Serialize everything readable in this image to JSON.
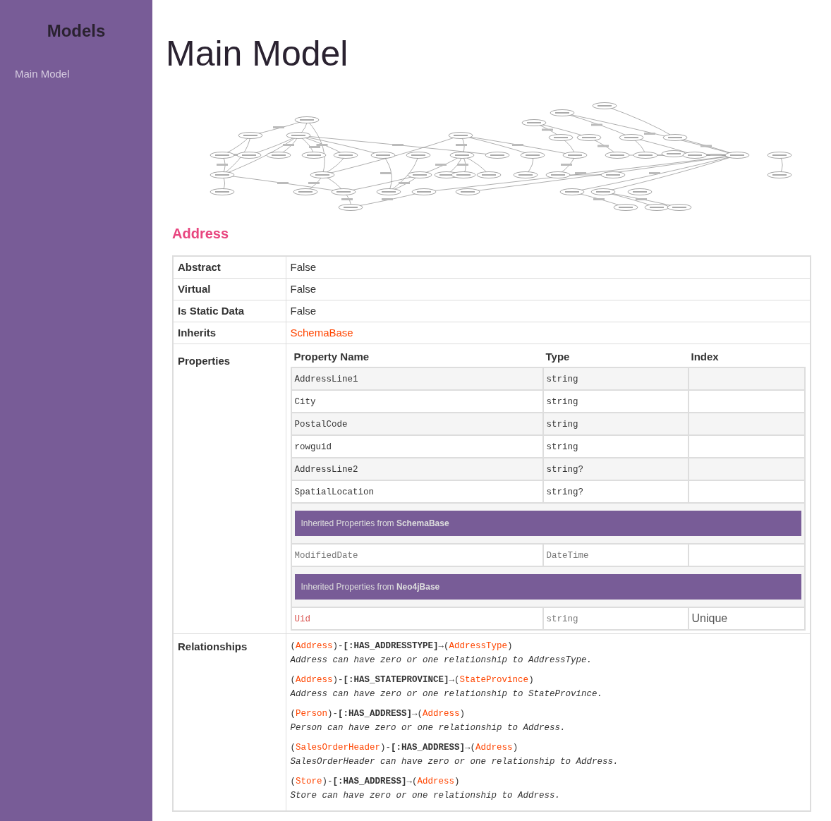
{
  "sidebar": {
    "title": "Models",
    "items": [
      {
        "label": "Main Model",
        "selected": false
      }
    ]
  },
  "page_title": "Main Model",
  "entity": {
    "name": "Address",
    "attributes": [
      {
        "label": "Abstract",
        "value": "False",
        "kind": "text"
      },
      {
        "label": "Virtual",
        "value": "False",
        "kind": "text"
      },
      {
        "label": "Is Static Data",
        "value": "False",
        "kind": "text"
      },
      {
        "label": "Inherits",
        "value": "SchemaBase",
        "kind": "link"
      }
    ],
    "properties": {
      "label": "Properties",
      "columns": [
        "Property Name",
        "Type",
        "Index"
      ],
      "rows": [
        {
          "kind": "property",
          "name": "AddressLine1",
          "type": "string",
          "index": "",
          "inherited": false,
          "highlighted": false
        },
        {
          "kind": "property",
          "name": "City",
          "type": "string",
          "index": "",
          "inherited": false,
          "highlighted": false
        },
        {
          "kind": "property",
          "name": "PostalCode",
          "type": "string",
          "index": "",
          "inherited": false,
          "highlighted": false
        },
        {
          "kind": "property",
          "name": "rowguid",
          "type": "string",
          "index": "",
          "inherited": false,
          "highlighted": false
        },
        {
          "kind": "property",
          "name": "AddressLine2",
          "type": "string?",
          "index": "",
          "inherited": false,
          "highlighted": false
        },
        {
          "kind": "property",
          "name": "SpatialLocation",
          "type": "string?",
          "index": "",
          "inherited": false,
          "highlighted": false
        },
        {
          "kind": "header",
          "text": "Inherited Properties from **SchemaBase**"
        },
        {
          "kind": "property",
          "name": "ModifiedDate",
          "type": "DateTime",
          "index": "",
          "inherited": true,
          "highlighted": false
        },
        {
          "kind": "header",
          "text": "Inherited Properties from **Neo4jBase**"
        },
        {
          "kind": "property",
          "name": "Uid",
          "type": "string",
          "index": "Unique",
          "inherited": true,
          "highlighted": true
        }
      ]
    },
    "relationships": {
      "label": "Relationships",
      "items": [
        {
          "pattern": [
            {
              "kind": "punct",
              "text": "("
            },
            {
              "kind": "entity",
              "text": "Address"
            },
            {
              "kind": "punct",
              "text": ")-"
            },
            {
              "kind": "type",
              "text": "[:HAS_ADDRESSTYPE]"
            },
            {
              "kind": "punct",
              "text": "→("
            },
            {
              "kind": "entity",
              "text": "AddressType"
            },
            {
              "kind": "punct",
              "text": ")"
            }
          ],
          "description": "Address can have zero or one relationship to AddressType."
        },
        {
          "pattern": [
            {
              "kind": "punct",
              "text": "("
            },
            {
              "kind": "entity",
              "text": "Address"
            },
            {
              "kind": "punct",
              "text": ")-"
            },
            {
              "kind": "type",
              "text": "[:HAS_STATEPROVINCE]"
            },
            {
              "kind": "punct",
              "text": "→("
            },
            {
              "kind": "entity",
              "text": "StateProvince"
            },
            {
              "kind": "punct",
              "text": ")"
            }
          ],
          "description": "Address can have zero or one relationship to StateProvince."
        },
        {
          "pattern": [
            {
              "kind": "punct",
              "text": "("
            },
            {
              "kind": "entity",
              "text": "Person"
            },
            {
              "kind": "punct",
              "text": ")-"
            },
            {
              "kind": "type",
              "text": "[:HAS_ADDRESS]"
            },
            {
              "kind": "punct",
              "text": "→("
            },
            {
              "kind": "entity",
              "text": "Address"
            },
            {
              "kind": "punct",
              "text": ")"
            }
          ],
          "description": "Person can have zero or one relationship to Address."
        },
        {
          "pattern": [
            {
              "kind": "punct",
              "text": "("
            },
            {
              "kind": "entity",
              "text": "SalesOrderHeader"
            },
            {
              "kind": "punct",
              "text": ")-"
            },
            {
              "kind": "type",
              "text": "[:HAS_ADDRESS]"
            },
            {
              "kind": "punct",
              "text": "→("
            },
            {
              "kind": "entity",
              "text": "Address"
            },
            {
              "kind": "punct",
              "text": ")"
            }
          ],
          "description": "SalesOrderHeader can have zero or one relationship to Address."
        },
        {
          "pattern": [
            {
              "kind": "punct",
              "text": "("
            },
            {
              "kind": "entity",
              "text": "Store"
            },
            {
              "kind": "punct",
              "text": ")-"
            },
            {
              "kind": "type",
              "text": "[:HAS_ADDRESS]"
            },
            {
              "kind": "punct",
              "text": "→("
            },
            {
              "kind": "entity",
              "text": "Address"
            },
            {
              "kind": "punct",
              "text": ")"
            }
          ],
          "description": "Store can have zero or one relationship to Address."
        }
      ]
    }
  }
}
